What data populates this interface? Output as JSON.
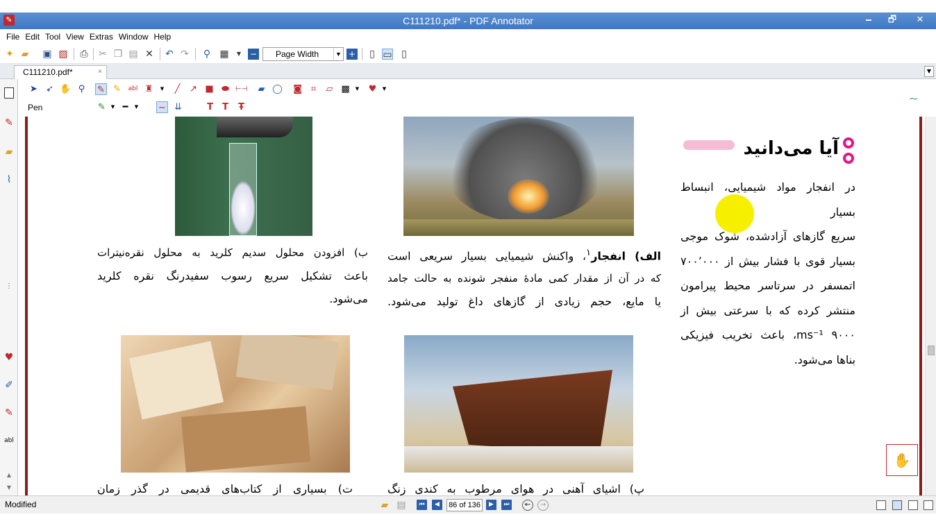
{
  "window": {
    "title": "C111210.pdf* - PDF Annotator",
    "minimize": "🗕",
    "maximize": "🗗",
    "close": "✕"
  },
  "menu": [
    "File",
    "Edit",
    "Tool",
    "View",
    "Extras",
    "Window",
    "Help"
  ],
  "toolbar": {
    "zoom_value": "Page Width"
  },
  "tab": {
    "label": "C111210.pdf*",
    "close": "×"
  },
  "annot_toolbar": {
    "tool_label": "Pen"
  },
  "page": {
    "sidebar_title": "آیا می‌دانید",
    "sidebar_lines": [
      "در انفجار مواد شیمیایی، انبساط بسیار",
      "سریع گازهای آزادشده، شوک موجی",
      "بسیار قوی با فشار بیش از ۷۰۰٬۰۰۰",
      "اتمسفر در سرتاسر محیط پیرامون",
      "منتشر کرده که با سرعتی بیش از",
      "ms⁻¹ ۹۰۰۰، باعث تخریب فیزیکی",
      "بناها می‌شود."
    ],
    "caption_alef_bold": "الف) انفجار",
    "caption_alef_sup": "۱",
    "caption_alef_l1": "، واکنش شیمیایی بسیار سریعی است",
    "caption_alef_l2": "که در آن از مقدار کمی مادهٔ منفجر شونده به حالت جامد",
    "caption_alef_l3": "یا مایع، حجم زیادی از گازهای داغ تولید می‌شود.",
    "caption_be_l1": "ب) افزودن محلول سدیم کلرید به محلول نقره‌نیترات",
    "caption_be_l2": "باعث تشکیل سریع رسوب سفیدرنگ نقره کلرید",
    "caption_be_l3": "می‌شود.",
    "caption_pe": "پ) اشیای آهنی در هوای مرطوب به کندی زنگ",
    "caption_te": "ت) بسیاری از کتاب‌های قدیمی در گذر زمان"
  },
  "status": {
    "text": "Modified",
    "page_field": "86 of 136"
  },
  "colors": {
    "titlebar": "#3f78c4",
    "accent_pink": "#e0168a",
    "highlight": "#f6f000",
    "page_border": "#8a1d1d"
  }
}
